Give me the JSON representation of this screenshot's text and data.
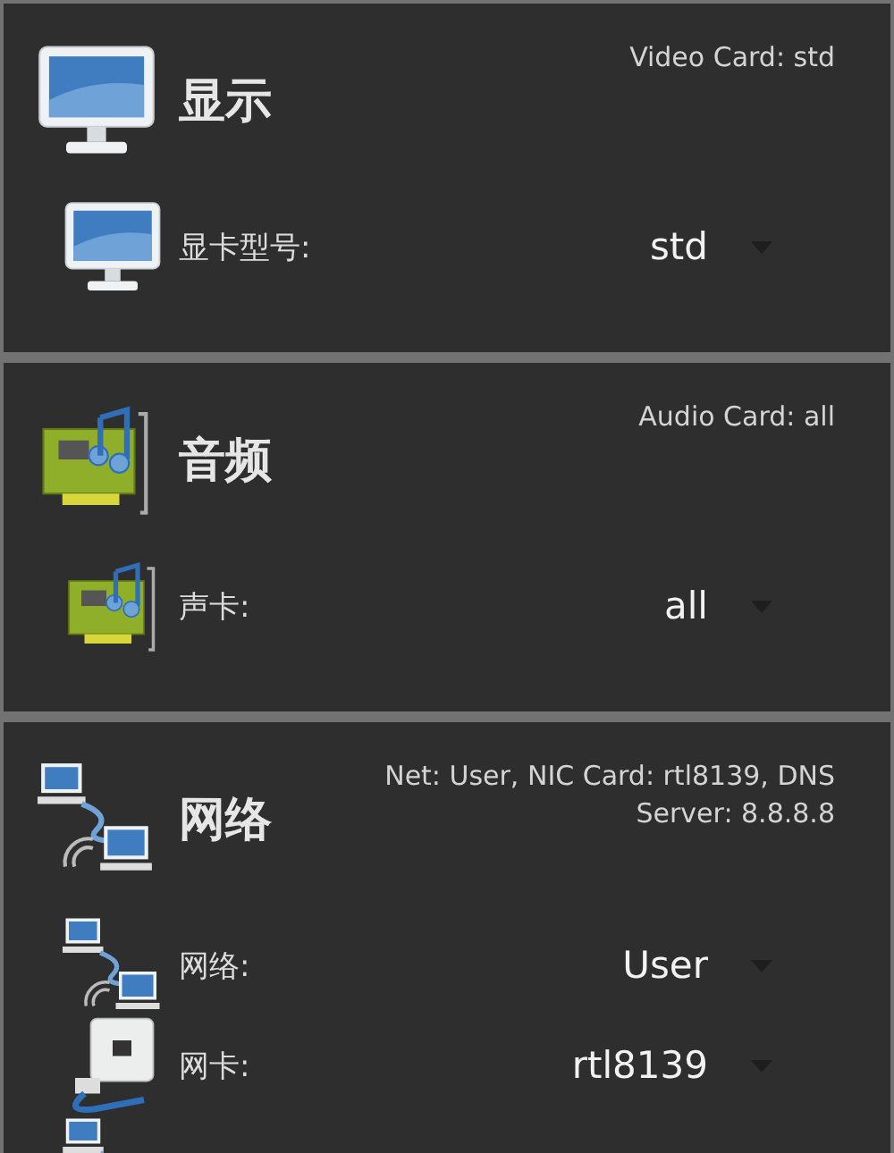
{
  "sections": [
    {
      "kind": "monitor",
      "title": "显示",
      "summary": "Video Card: std",
      "rows": [
        {
          "kind": "monitor",
          "label": "显卡型号:",
          "value": "std"
        }
      ]
    },
    {
      "kind": "audio-card",
      "title": "音频",
      "summary": "Audio Card: all",
      "rows": [
        {
          "kind": "audio-card",
          "label": "声卡:",
          "value": "all"
        }
      ]
    },
    {
      "kind": "network",
      "title": "网络",
      "summary": "Net: User, NIC Card: rtl8139, DNS Server: 8.8.8.8",
      "rows": [
        {
          "kind": "network",
          "label": "网络:",
          "value": "User"
        },
        {
          "kind": "nic",
          "label": "网卡:",
          "value": "rtl8139"
        },
        {
          "kind": "network"
        }
      ]
    }
  ]
}
